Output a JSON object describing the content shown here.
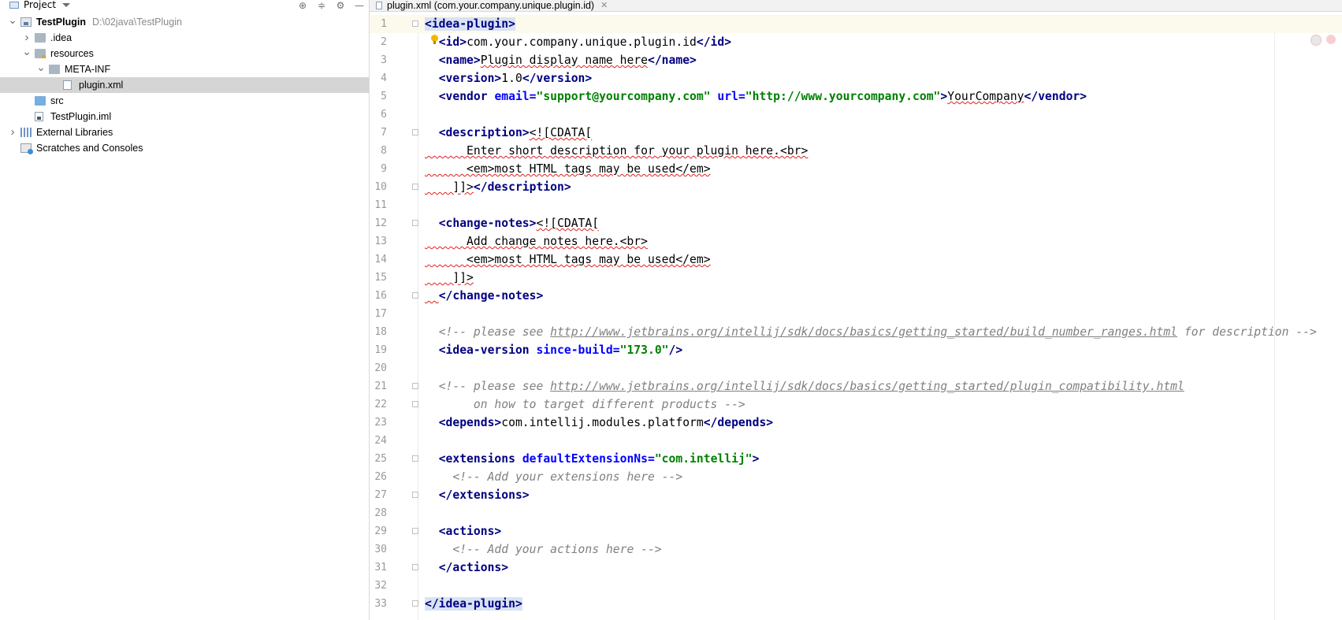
{
  "project_panel": {
    "title": "Project",
    "tree": [
      {
        "label": "TestPlugin",
        "path": "D:\\02java\\TestPlugin",
        "depth": 0,
        "expand": "open",
        "icon": "module-icon",
        "bold": true
      },
      {
        "label": ".idea",
        "depth": 1,
        "expand": "closed",
        "icon": "folder-icon"
      },
      {
        "label": "resources",
        "depth": 1,
        "expand": "open",
        "icon": "resources-folder-icon"
      },
      {
        "label": "META-INF",
        "depth": 2,
        "expand": "open",
        "icon": "folder-icon"
      },
      {
        "label": "plugin.xml",
        "depth": 3,
        "expand": "none",
        "icon": "xml-file-icon",
        "selected": true
      },
      {
        "label": "src",
        "depth": 1,
        "expand": "none",
        "icon": "source-folder-icon"
      },
      {
        "label": "TestPlugin.iml",
        "depth": 1,
        "expand": "none",
        "icon": "iml-file-icon"
      },
      {
        "label": "External Libraries",
        "depth": 0,
        "expand": "closed",
        "icon": "libraries-icon"
      },
      {
        "label": "Scratches and Consoles",
        "depth": 0,
        "expand": "none",
        "icon": "scratches-icon"
      }
    ]
  },
  "editor": {
    "tab": {
      "label": "plugin.xml (com.your.company.unique.plugin.id)",
      "close_glyph": "✕"
    },
    "lines": [
      {
        "n": "1",
        "hl": true,
        "fold": true,
        "parts": [
          [
            "tag",
            "<idea-plugin>"
          ]
        ]
      },
      {
        "n": "2",
        "bulb": true,
        "parts": [
          [
            "txt",
            "  "
          ],
          [
            "tag",
            "<id>"
          ],
          [
            "txt",
            "com.your.company.unique.plugin.id"
          ],
          [
            "tag",
            "</id>"
          ]
        ]
      },
      {
        "n": "3",
        "parts": [
          [
            "txt",
            "  "
          ],
          [
            "tag",
            "<name>"
          ],
          [
            "sq",
            "Plugin display name here"
          ],
          [
            "tag",
            "</name>"
          ]
        ]
      },
      {
        "n": "4",
        "parts": [
          [
            "txt",
            "  "
          ],
          [
            "tag",
            "<version>"
          ],
          [
            "txt",
            "1.0"
          ],
          [
            "tag",
            "</version>"
          ]
        ]
      },
      {
        "n": "5",
        "parts": [
          [
            "txt",
            "  "
          ],
          [
            "tag",
            "<vendor "
          ],
          [
            "attr",
            "email="
          ],
          [
            "val",
            "\"support@yourcompany.com\""
          ],
          [
            "txt",
            " "
          ],
          [
            "attr",
            "url="
          ],
          [
            "val",
            "\"http://www.yourcompany.com\""
          ],
          [
            "tag",
            ">"
          ],
          [
            "sq",
            "YourCompany"
          ],
          [
            "tag",
            "</vendor>"
          ]
        ]
      },
      {
        "n": "6",
        "parts": []
      },
      {
        "n": "7",
        "fold": true,
        "parts": [
          [
            "txt",
            "  "
          ],
          [
            "tag",
            "<description>"
          ],
          [
            "sq",
            "<![CDATA["
          ]
        ]
      },
      {
        "n": "8",
        "parts": [
          [
            "sq",
            "      Enter short description for your plugin here.<br>"
          ]
        ]
      },
      {
        "n": "9",
        "parts": [
          [
            "sq",
            "      <em>most HTML tags may be used</em>"
          ]
        ]
      },
      {
        "n": "10",
        "fold": true,
        "parts": [
          [
            "sq",
            "    ]]>"
          ],
          [
            "tag",
            "</description>"
          ]
        ]
      },
      {
        "n": "11",
        "parts": []
      },
      {
        "n": "12",
        "fold": true,
        "parts": [
          [
            "txt",
            "  "
          ],
          [
            "tag",
            "<change-notes>"
          ],
          [
            "sq",
            "<![CDATA["
          ]
        ]
      },
      {
        "n": "13",
        "parts": [
          [
            "sq",
            "      Add change notes here.<br>"
          ]
        ]
      },
      {
        "n": "14",
        "parts": [
          [
            "sq",
            "      <em>most HTML tags may be used</em>"
          ]
        ]
      },
      {
        "n": "15",
        "parts": [
          [
            "sq",
            "    ]]>"
          ]
        ]
      },
      {
        "n": "16",
        "fold": true,
        "parts": [
          [
            "sq",
            "  "
          ],
          [
            "tag",
            "</change-notes>"
          ]
        ]
      },
      {
        "n": "17",
        "parts": []
      },
      {
        "n": "18",
        "parts": [
          [
            "txt",
            "  "
          ],
          [
            "cmt",
            "<!-- please see "
          ],
          [
            "cmtlink",
            "http://www.jetbrains.org/intellij/sdk/docs/basics/getting_started/build_number_ranges.html"
          ],
          [
            "cmt",
            " for description -->"
          ]
        ]
      },
      {
        "n": "19",
        "parts": [
          [
            "txt",
            "  "
          ],
          [
            "tag",
            "<idea-version "
          ],
          [
            "attr",
            "since-build="
          ],
          [
            "val",
            "\"173.0\""
          ],
          [
            "tag",
            "/>"
          ]
        ]
      },
      {
        "n": "20",
        "parts": []
      },
      {
        "n": "21",
        "fold": true,
        "parts": [
          [
            "txt",
            "  "
          ],
          [
            "cmt",
            "<!-- please see "
          ],
          [
            "cmtlink",
            "http://www.jetbrains.org/intellij/sdk/docs/basics/getting_started/plugin_compatibility.html"
          ]
        ]
      },
      {
        "n": "22",
        "fold": true,
        "parts": [
          [
            "cmt",
            "       on how to target different products -->"
          ]
        ]
      },
      {
        "n": "23",
        "parts": [
          [
            "txt",
            "  "
          ],
          [
            "tag",
            "<depends>"
          ],
          [
            "txt",
            "com.intellij.modules.platform"
          ],
          [
            "tag",
            "</depends>"
          ]
        ]
      },
      {
        "n": "24",
        "parts": []
      },
      {
        "n": "25",
        "fold": true,
        "parts": [
          [
            "txt",
            "  "
          ],
          [
            "tag",
            "<extensions "
          ],
          [
            "attr",
            "defaultExtensionNs="
          ],
          [
            "val",
            "\"com.intellij\""
          ],
          [
            "tag",
            ">"
          ]
        ]
      },
      {
        "n": "26",
        "parts": [
          [
            "txt",
            "    "
          ],
          [
            "cmt",
            "<!-- Add your extensions here -->"
          ]
        ]
      },
      {
        "n": "27",
        "fold": true,
        "parts": [
          [
            "txt",
            "  "
          ],
          [
            "tag",
            "</extensions>"
          ]
        ]
      },
      {
        "n": "28",
        "parts": []
      },
      {
        "n": "29",
        "fold": true,
        "parts": [
          [
            "txt",
            "  "
          ],
          [
            "tag",
            "<actions>"
          ]
        ]
      },
      {
        "n": "30",
        "parts": [
          [
            "txt",
            "    "
          ],
          [
            "cmt",
            "<!-- Add your actions here -->"
          ]
        ]
      },
      {
        "n": "31",
        "fold": true,
        "parts": [
          [
            "txt",
            "  "
          ],
          [
            "tag",
            "</actions>"
          ]
        ]
      },
      {
        "n": "32",
        "parts": []
      },
      {
        "n": "33",
        "hl": true,
        "fold": true,
        "parts": [
          [
            "tag",
            "</idea-plugin>"
          ]
        ]
      }
    ]
  }
}
